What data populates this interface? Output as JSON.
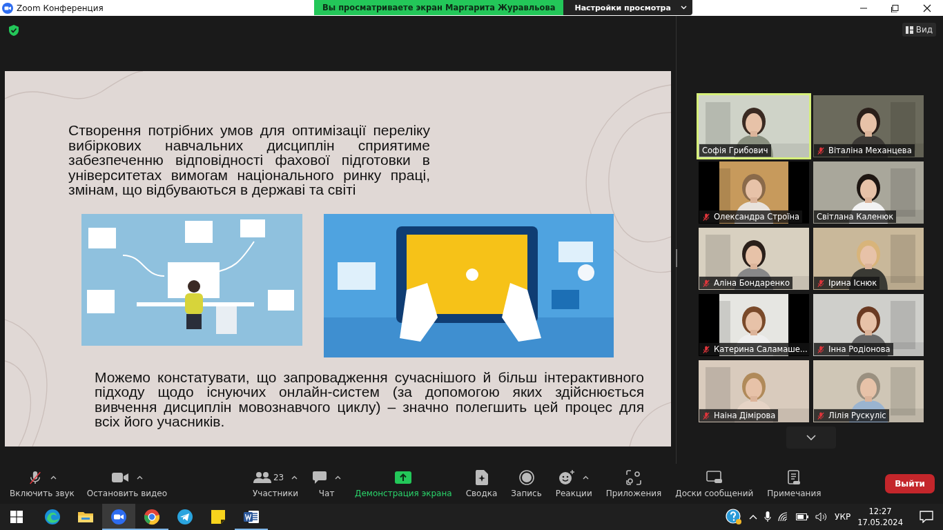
{
  "window": {
    "title": "Zoom Конференция"
  },
  "share_banner": {
    "text": "Вы просматриваете экран Маргарита Журавльова",
    "options_label": "Настройки просмотра"
  },
  "view_button": {
    "label": "Вид"
  },
  "slide": {
    "paragraphs": [
      "Створення потрібних умов для оптимізації переліку вибіркових навчальних дисциплін сприятиме забезпеченню відповідності фахової підготовки в університетах вимогам національного ринку праці, змінам, що відбуваються в державі та світі",
      " Можемо констатувати, що запровадження сучаснішого й більш інтерактивного підходу щодо існуючих онлайн-систем (за допомогою яких здійснюється вивчення дисциплін мовознавчого циклу) – значно полегшить цей процес для всіх його учасників."
    ]
  },
  "participants": [
    {
      "name": "Софія Грибович",
      "muted": false,
      "speaking": true,
      "pillarbox": false
    },
    {
      "name": "Віталіна Механцева",
      "muted": true,
      "speaking": false,
      "pillarbox": false
    },
    {
      "name": "Олександра Строїна",
      "muted": true,
      "speaking": false,
      "pillarbox": true
    },
    {
      "name": "Світлана Каленюк",
      "muted": false,
      "speaking": false,
      "pillarbox": false
    },
    {
      "name": "Аліна Бондаренко",
      "muted": true,
      "speaking": false,
      "pillarbox": false
    },
    {
      "name": "Ірина Існюк",
      "muted": true,
      "speaking": false,
      "pillarbox": false
    },
    {
      "name": "Катерина Саламаше...",
      "muted": true,
      "speaking": false,
      "pillarbox": true
    },
    {
      "name": "Інна Родіонова",
      "muted": true,
      "speaking": false,
      "pillarbox": false
    },
    {
      "name": "Наіна Дімірова",
      "muted": true,
      "speaking": false,
      "pillarbox": false
    },
    {
      "name": "Лілія Рускуліс",
      "muted": true,
      "speaking": false,
      "pillarbox": false
    }
  ],
  "toolbar": {
    "items": [
      {
        "kind": "mic",
        "label": "Включить звук",
        "muted": true,
        "caret": true,
        "active": false
      },
      {
        "kind": "video",
        "label": "Остановить видео",
        "caret": true,
        "active": false
      },
      {
        "kind": "participants",
        "label": "Участники",
        "count": "23",
        "caret": true,
        "active": false
      },
      {
        "kind": "chat",
        "label": "Чат",
        "caret": true,
        "active": false
      },
      {
        "kind": "share",
        "label": "Демонстрация экрана",
        "caret": false,
        "active": true
      },
      {
        "kind": "summary",
        "label": "Сводка",
        "caret": false,
        "active": false
      },
      {
        "kind": "record",
        "label": "Запись",
        "caret": false,
        "active": false
      },
      {
        "kind": "reactions",
        "label": "Реакции",
        "caret": true,
        "active": false
      },
      {
        "kind": "apps",
        "label": "Приложения",
        "caret": false,
        "active": false
      },
      {
        "kind": "boards",
        "label": "Доски сообщений",
        "caret": false,
        "active": false
      },
      {
        "kind": "notes",
        "label": "Примечания",
        "caret": false,
        "active": false
      }
    ],
    "leave": "Выйти"
  },
  "taskbar": {
    "apps": [
      {
        "kind": "edge",
        "running": false,
        "active": false
      },
      {
        "kind": "explorer",
        "running": false,
        "active": false
      },
      {
        "kind": "zoom",
        "running": true,
        "active": true
      },
      {
        "kind": "chrome",
        "running": true,
        "active": false
      },
      {
        "kind": "telegram",
        "running": false,
        "active": false
      },
      {
        "kind": "notes",
        "running": false,
        "active": false
      },
      {
        "kind": "word",
        "running": true,
        "active": false
      }
    ],
    "language": "УКР",
    "time": "12:27",
    "date": "17.05.2024"
  }
}
